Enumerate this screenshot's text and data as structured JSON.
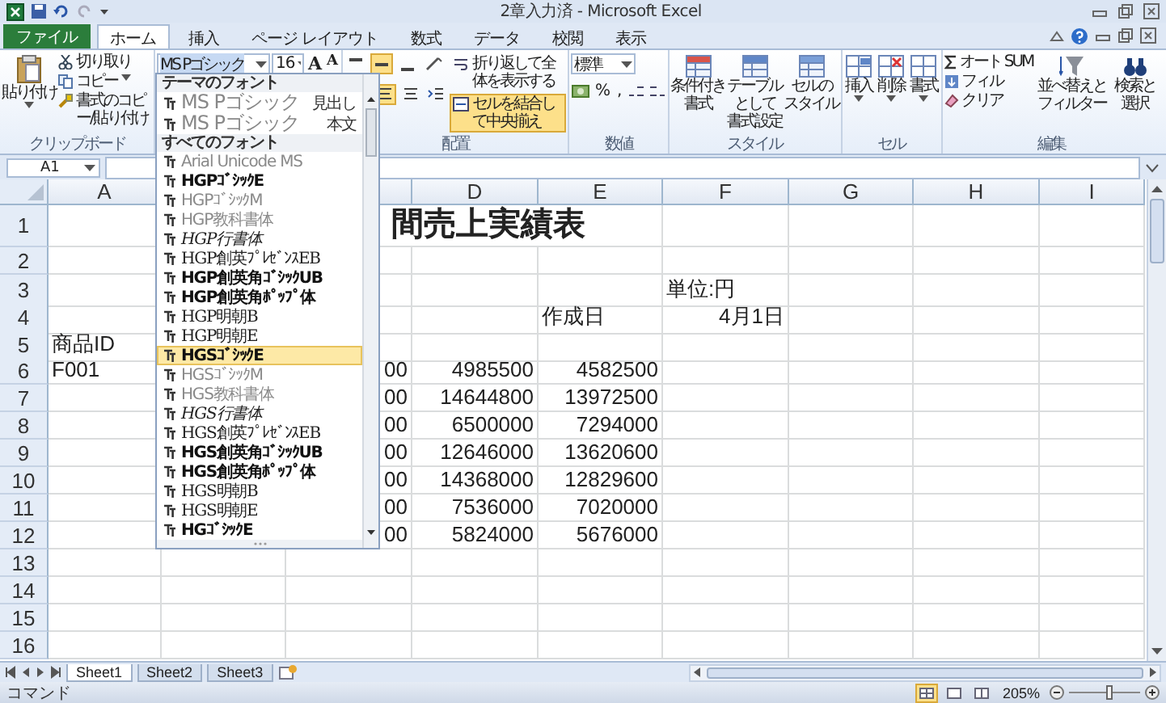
{
  "window": {
    "title": "2章入力済 - Microsoft Excel"
  },
  "tabs": [
    {
      "label": "ファイル",
      "kind": "file",
      "selected": false
    },
    {
      "label": "ホーム",
      "kind": "tab",
      "selected": true
    },
    {
      "label": "挿入",
      "kind": "tab",
      "selected": false
    },
    {
      "label": "ページ レイアウト",
      "kind": "tab",
      "selected": false
    },
    {
      "label": "数式",
      "kind": "tab",
      "selected": false
    },
    {
      "label": "データ",
      "kind": "tab",
      "selected": false
    },
    {
      "label": "校閲",
      "kind": "tab",
      "selected": false
    },
    {
      "label": "表示",
      "kind": "tab",
      "selected": false
    }
  ],
  "ribbon": {
    "clipboard": {
      "paste": "貼り付け",
      "cut": "切り取り",
      "copy": "コピー",
      "format_painter": "書式のコピー/貼り付け",
      "label": "クリップボード"
    },
    "font": {
      "name": "MS Pゴシック",
      "size": "16",
      "grow": "A",
      "shrink": "A"
    },
    "alignment": {
      "vertical": [
        {
          "selected": false
        },
        {
          "selected": true
        },
        {
          "selected": false
        }
      ],
      "horizontal": [
        {
          "selected": true
        },
        {
          "selected": false
        }
      ],
      "wrap_text": {
        "label": "折り返して全体を表示する",
        "selected": false
      },
      "merge": {
        "label": "セルを結合して中央揃え",
        "selected": true
      },
      "label": "配置"
    },
    "number": {
      "format": "標準",
      "percent": "%",
      "comma": ",",
      "label": "数値"
    },
    "styles": {
      "buttons": [
        {
          "lines": [
            "条件付き",
            "書式"
          ]
        },
        {
          "lines": [
            "テーブルとして",
            "書式設定"
          ]
        },
        {
          "lines": [
            "セルの",
            "スタイル"
          ]
        }
      ],
      "label": "スタイル"
    },
    "cells": {
      "buttons": [
        "挿入",
        "削除",
        "書式"
      ],
      "label": "セル"
    },
    "editing": {
      "autosum": "オート SUM",
      "fill": "フィル",
      "clear": "クリア",
      "sort": [
        "並べ替えと",
        "フィルター"
      ],
      "find": [
        "検索と",
        "選択"
      ],
      "label": "編集"
    }
  },
  "font_dropdown": {
    "theme_header": "テーマのフォント",
    "theme_fonts": [
      {
        "name": "MS Pゴシック",
        "role": "見出し"
      },
      {
        "name": "MS Pゴシック",
        "role": "本文"
      }
    ],
    "all_header": "すべてのフォント",
    "fonts": [
      {
        "name": "Arial Unicode MS",
        "kind": "light",
        "selected": false
      },
      {
        "name": "HGPｺﾞｼｯｸE",
        "kind": "bold",
        "selected": false
      },
      {
        "name": "HGPｺﾞｼｯｸM",
        "kind": "light",
        "selected": false
      },
      {
        "name": "HGP教科書体",
        "kind": "light",
        "selected": false
      },
      {
        "name": "HGP行書体",
        "kind": "script",
        "selected": false
      },
      {
        "name": "HGP創英ﾌﾟﾚｾﾞﾝｽEB",
        "kind": "serif",
        "selected": false
      },
      {
        "name": "HGP創英角ｺﾞｼｯｸUB",
        "kind": "bold",
        "selected": false
      },
      {
        "name": "HGP創英角ﾎﾟｯﾌﾟ体",
        "kind": "bold",
        "selected": false
      },
      {
        "name": "HGP明朝B",
        "kind": "serif",
        "selected": false
      },
      {
        "name": "HGP明朝E",
        "kind": "serif",
        "selected": false
      },
      {
        "name": "HGSｺﾞｼｯｸE",
        "kind": "bold",
        "selected": true
      },
      {
        "name": "HGSｺﾞｼｯｸM",
        "kind": "light",
        "selected": false
      },
      {
        "name": "HGS教科書体",
        "kind": "light",
        "selected": false
      },
      {
        "name": "HGS行書体",
        "kind": "script",
        "selected": false
      },
      {
        "name": "HGS創英ﾌﾟﾚｾﾞﾝｽEB",
        "kind": "serif",
        "selected": false
      },
      {
        "name": "HGS創英角ｺﾞｼｯｸUB",
        "kind": "bold",
        "selected": false
      },
      {
        "name": "HGS創英角ﾎﾟｯﾌﾟ体",
        "kind": "bold",
        "selected": false
      },
      {
        "name": "HGS明朝B",
        "kind": "serif",
        "selected": false
      },
      {
        "name": "HGS明朝E",
        "kind": "serif",
        "selected": false
      },
      {
        "name": "HGｺﾞｼｯｸE",
        "kind": "bold",
        "selected": false
      }
    ]
  },
  "formula_bar": {
    "name_box": "A1"
  },
  "sheet": {
    "columns": [
      {
        "label": "A"
      },
      {},
      {},
      {
        "label": "D"
      },
      {
        "label": "E"
      },
      {
        "label": "F"
      },
      {
        "label": "G"
      },
      {
        "label": "H"
      },
      {
        "label": "I"
      }
    ],
    "rows": [
      {
        "number": "1",
        "cells": [
          {},
          {},
          {
            "text": "間売上実績表",
            "kind": "title"
          }
        ]
      },
      {
        "number": "2",
        "cells": []
      },
      {
        "number": "3",
        "cells": [
          {},
          {},
          {},
          {},
          {},
          {
            "text": "単位:円",
            "kind": "text"
          }
        ]
      },
      {
        "number": "4",
        "cells": [
          {},
          {},
          {},
          {},
          {
            "text": "作成日",
            "kind": "text"
          },
          {
            "text": "4月1日",
            "kind": "number"
          }
        ]
      },
      {
        "number": "5",
        "cells": [
          {
            "text": "商品ID",
            "kind": "text"
          }
        ]
      },
      {
        "number": "6",
        "cells": [
          {
            "text": "F001",
            "kind": "text"
          },
          {},
          {
            "text": "00",
            "kind": "number"
          },
          {
            "text": "4985500",
            "kind": "number"
          },
          {
            "text": "4582500",
            "kind": "number"
          }
        ]
      },
      {
        "number": "7",
        "cells": [
          {},
          {},
          {
            "text": "00",
            "kind": "number"
          },
          {
            "text": "14644800",
            "kind": "number"
          },
          {
            "text": "13972500",
            "kind": "number"
          }
        ]
      },
      {
        "number": "8",
        "cells": [
          {},
          {},
          {
            "text": "00",
            "kind": "number"
          },
          {
            "text": "6500000",
            "kind": "number"
          },
          {
            "text": "7294000",
            "kind": "number"
          }
        ]
      },
      {
        "number": "9",
        "cells": [
          {},
          {},
          {
            "text": "00",
            "kind": "number"
          },
          {
            "text": "12646000",
            "kind": "number"
          },
          {
            "text": "13620600",
            "kind": "number"
          }
        ]
      },
      {
        "number": "10",
        "cells": [
          {},
          {},
          {
            "text": "00",
            "kind": "number"
          },
          {
            "text": "14368000",
            "kind": "number"
          },
          {
            "text": "12829600",
            "kind": "number"
          }
        ]
      },
      {
        "number": "11",
        "cells": [
          {},
          {},
          {
            "text": "00",
            "kind": "number"
          },
          {
            "text": "7536000",
            "kind": "number"
          },
          {
            "text": "7020000",
            "kind": "number"
          }
        ]
      },
      {
        "number": "12",
        "cells": [
          {},
          {},
          {
            "text": "00",
            "kind": "number"
          },
          {
            "text": "5824000",
            "kind": "number"
          },
          {
            "text": "5676000",
            "kind": "number"
          }
        ]
      },
      {
        "number": "13",
        "cells": []
      },
      {
        "number": "14",
        "cells": []
      },
      {
        "number": "15",
        "cells": []
      },
      {
        "number": "16",
        "cells": []
      }
    ]
  },
  "sheet_tabs": [
    {
      "label": "Sheet1",
      "selected": true
    },
    {
      "label": "Sheet2",
      "selected": false
    },
    {
      "label": "Sheet3",
      "selected": false
    }
  ],
  "status_bar": {
    "mode": "コマンド",
    "views": [
      {
        "selected": true
      },
      {
        "selected": false
      },
      {
        "selected": false
      }
    ],
    "zoom": "205%",
    "zoom_slider": {
      "level": 0.57
    }
  }
}
